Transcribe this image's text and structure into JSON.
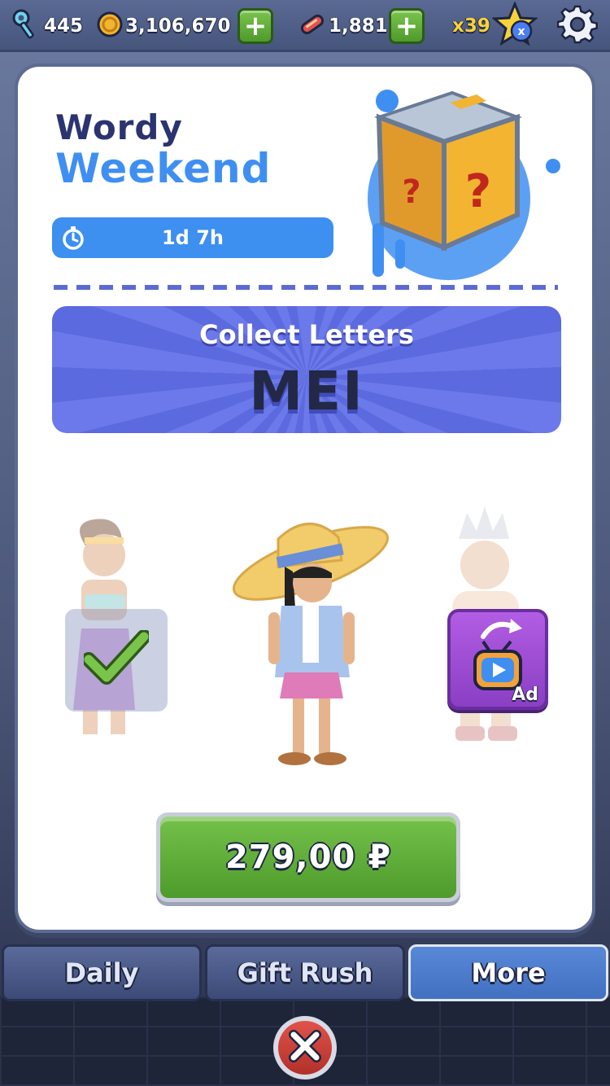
{
  "topbar": {
    "keys": "445",
    "coins": "3,106,670",
    "boards": "1,881",
    "multiplier": "x39"
  },
  "event": {
    "title_line1": "Wordy",
    "title_line2": "Weekend",
    "timer": "1d 7h"
  },
  "collect": {
    "label": "Collect Letters",
    "word": "MEI"
  },
  "characters": {
    "ad_label": "Ad"
  },
  "purchase": {
    "price": "279,00 ₽"
  },
  "tabs": [
    {
      "label": "Daily"
    },
    {
      "label": "Gift Rush"
    },
    {
      "label": "More"
    }
  ],
  "colors": {
    "accent_blue": "#3f8ff2",
    "title_navy": "#2b3470",
    "buy_green": "#5fae38",
    "collect_purple": "#6c79ea"
  }
}
